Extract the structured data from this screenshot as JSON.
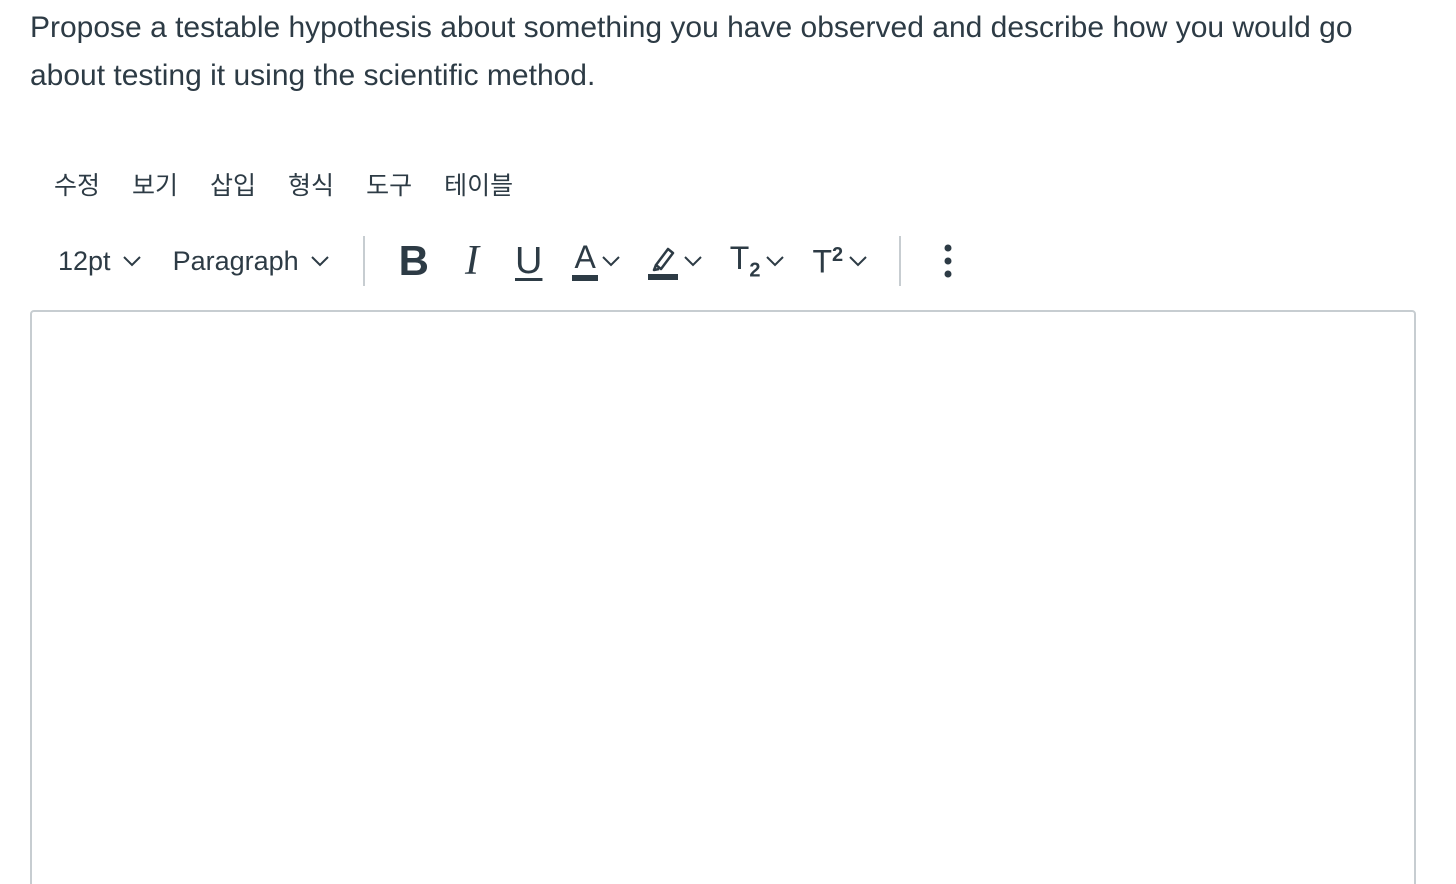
{
  "question": {
    "text": "Propose a testable hypothesis about something you have observed and describe how you would go about testing it using the scientific method."
  },
  "menubar": {
    "items": [
      "수정",
      "보기",
      "삽입",
      "형식",
      "도구",
      "테이블"
    ]
  },
  "toolbar": {
    "font_size": "12pt",
    "block_format": "Paragraph",
    "bold_label": "B",
    "italic_label": "I",
    "underline_label": "U",
    "text_color_label": "A",
    "subscript_label": "T",
    "subscript_mark": "2",
    "superscript_label": "T",
    "superscript_mark": "2",
    "icons": {
      "chevron": "chevron-down-icon",
      "highlight": "highlighter-icon",
      "more": "more-vertical-icon"
    }
  },
  "editor": {
    "content": ""
  },
  "colors": {
    "text": "#2d3b45",
    "border": "#c7cdd1",
    "background": "#ffffff"
  }
}
